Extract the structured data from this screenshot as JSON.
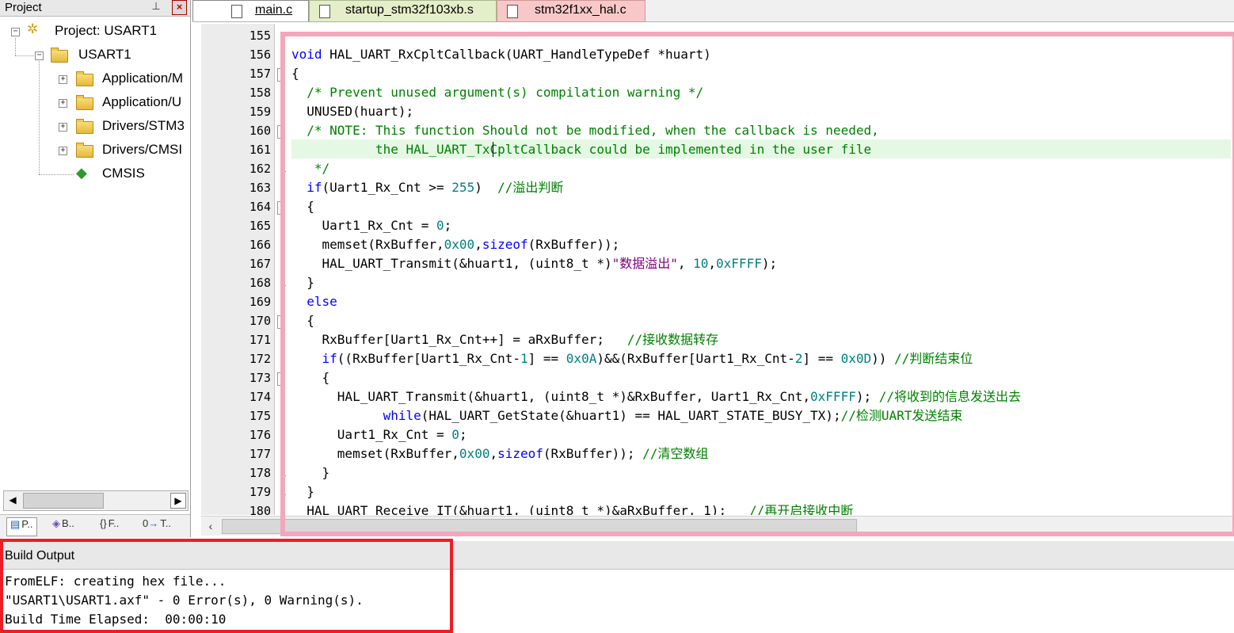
{
  "project": {
    "title": "Project",
    "tree": {
      "root": "Project: USART1",
      "target": "USART1",
      "groups": [
        "Application/M",
        "Application/U",
        "Drivers/STM3",
        "Drivers/CMSI",
        "CMSIS"
      ]
    },
    "bottom_tabs": [
      "P..",
      "B..",
      "F..",
      "T.."
    ]
  },
  "editor": {
    "tabs": [
      {
        "label": "main.c",
        "active": true,
        "color": "#ffffff"
      },
      {
        "label": "startup_stm32f103xb.s",
        "active": false,
        "color": "#e4eec8"
      },
      {
        "label": "stm32f1xx_hal.c",
        "active": false,
        "color": "#f8c8c8"
      }
    ],
    "line_numbers": [
      "155",
      "156",
      "157",
      "158",
      "159",
      "160",
      "161",
      "162",
      "163",
      "164",
      "165",
      "166",
      "167",
      "168",
      "169",
      "170",
      "171",
      "172",
      "173",
      "174",
      "175",
      "176",
      "177",
      "178",
      "179",
      "180"
    ],
    "highlight_color": "#f4a6bc"
  },
  "build": {
    "title": "Build Output",
    "lines": [
      "FromELF: creating hex file...",
      "\"USART1\\USART1.axf\" - 0 Error(s), 0 Warning(s).",
      "Build Time Elapsed:  00:00:10"
    ],
    "highlight_color": "#ee1c24"
  }
}
